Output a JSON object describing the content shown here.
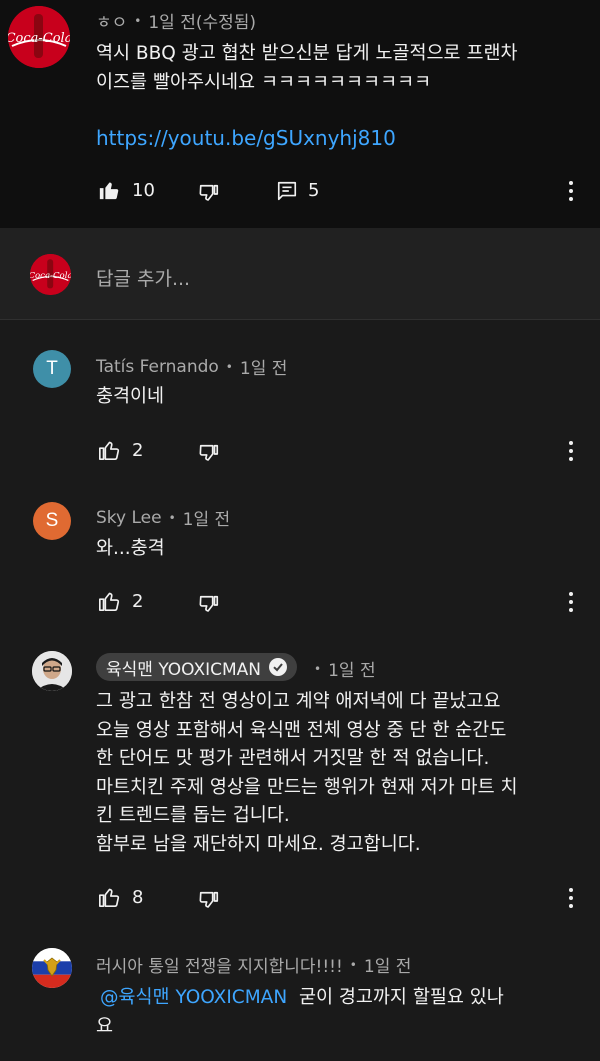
{
  "colors": {
    "link": "#3ea6ff",
    "background": "#000000",
    "avatar_t": "#3f8fa8",
    "avatar_s": "#e06a32"
  },
  "icons": {
    "like": "thumbs-up-icon",
    "dislike": "thumbs-down-icon",
    "replies": "comment-icon",
    "more": "more-vertical-icon"
  },
  "main_comment": {
    "author": "ㅎㅇ",
    "time": "1일 전(수정됨)",
    "text": "역시 BBQ 광고 협찬 받으신분 답게 노골적으로 프랜차\n이즈를 빨아주시네요 ㅋㅋㅋㅋㅋㅋㅋㅋㅋㅋ",
    "link": "https://youtu.be/gSUxnyhj810",
    "likes": "10",
    "replies": "5"
  },
  "reply_input": {
    "placeholder": "답글 추가..."
  },
  "replies": [
    {
      "author": "Tatís Fernando",
      "time": "1일 전",
      "avatar_letter": "T",
      "text": "충격이네",
      "likes": "2"
    },
    {
      "author": "Sky Lee",
      "time": "1일 전",
      "avatar_letter": "S",
      "text": "와...충격",
      "likes": "2"
    },
    {
      "author": "육식맨 YOOXICMAN",
      "time": "1일 전",
      "text": "그 광고 한참 전 영상이고 계약 애저녁에 다 끝났고요\n오늘 영상 포함해서 육식맨 전체 영상 중 단 한 순간도\n한 단어도 맛 평가 관련해서 거짓말 한 적 없습니다.\n마트치킨 주제 영상을 만드는 행위가 현재 저가 마트 치\n킨 트렌드를 돕는 겁니다.\n함부로 남을 재단하지 마세요. 경고합니다.",
      "likes": "8"
    },
    {
      "author": "러시아 통일 전쟁을 지지합니다!!!!",
      "time": "1일 전",
      "mention": "@육식맨 YOOXICMAN",
      "text_rest": "굳이 경고까지 할필요 있나",
      "text_line2": "요"
    }
  ]
}
